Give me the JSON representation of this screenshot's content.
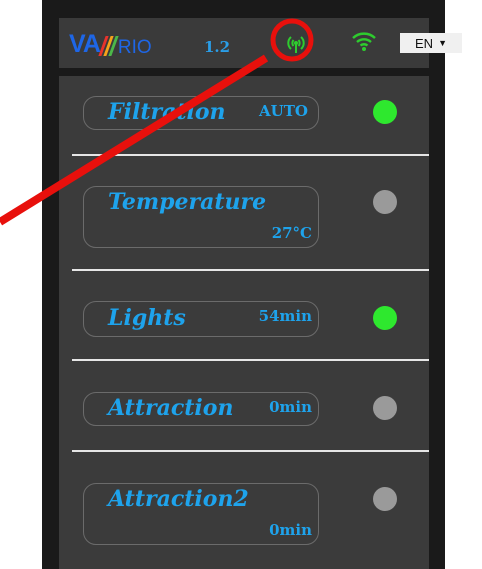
{
  "header": {
    "logo_va": "VA",
    "logo_rio": "RIO",
    "version": "1.2",
    "language": "EN",
    "bar_colors": [
      "#e8322c",
      "#f5a21b",
      "#4cb849",
      "#1e66e6"
    ]
  },
  "rows": [
    {
      "name": "Filtration",
      "value": "AUTO",
      "status": "on"
    },
    {
      "name": "Temperature",
      "value": "27°C",
      "status": "off"
    },
    {
      "name": "Lights",
      "value": "54min",
      "status": "on"
    },
    {
      "name": "Attraction",
      "value": "0min",
      "status": "off"
    },
    {
      "name": "Attraction2",
      "value": "0min",
      "status": "off"
    }
  ],
  "colors": {
    "accent_text": "#1ea3ec",
    "led_on": "#2ee82e",
    "led_off": "#9a9a9a",
    "annotation": "#e8100c",
    "signal_icon": "#2ecc2e"
  },
  "annotation": {
    "marker": "red-circle-around-antenna-icon"
  }
}
